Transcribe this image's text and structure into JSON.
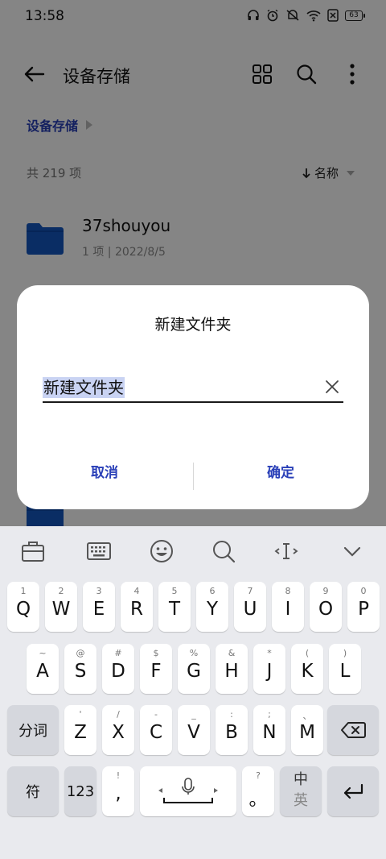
{
  "status": {
    "time": "13:58",
    "battery": "63"
  },
  "toolbar": {
    "title": "设备存储"
  },
  "breadcrumb": {
    "label": "设备存储"
  },
  "list": {
    "count": "共 219 项",
    "sort_label": "名称",
    "items": [
      {
        "name": "37shouyou",
        "meta": "1 项 | 2022/8/5"
      }
    ]
  },
  "dialog": {
    "title": "新建文件夹",
    "input_value": "新建文件夹",
    "cancel_label": "取消",
    "confirm_label": "确定"
  },
  "keyboard": {
    "row1": [
      {
        "hint": "1",
        "key": "Q"
      },
      {
        "hint": "2",
        "key": "W"
      },
      {
        "hint": "3",
        "key": "E"
      },
      {
        "hint": "4",
        "key": "R"
      },
      {
        "hint": "5",
        "key": "T"
      },
      {
        "hint": "6",
        "key": "Y"
      },
      {
        "hint": "7",
        "key": "U"
      },
      {
        "hint": "8",
        "key": "I"
      },
      {
        "hint": "9",
        "key": "O"
      },
      {
        "hint": "0",
        "key": "P"
      }
    ],
    "row2": [
      {
        "hint": "~",
        "key": "A"
      },
      {
        "hint": "@",
        "key": "S"
      },
      {
        "hint": "#",
        "key": "D"
      },
      {
        "hint": "$",
        "key": "F"
      },
      {
        "hint": "%",
        "key": "G"
      },
      {
        "hint": "&",
        "key": "H"
      },
      {
        "hint": "*",
        "key": "J"
      },
      {
        "hint": "(",
        "key": "K"
      },
      {
        "hint": ")",
        "key": "L"
      }
    ],
    "row3": [
      {
        "hint": "'",
        "key": "Z"
      },
      {
        "hint": "/",
        "key": "X"
      },
      {
        "hint": "-",
        "key": "C"
      },
      {
        "hint": "_",
        "key": "V"
      },
      {
        "hint": ":",
        "key": "B"
      },
      {
        "hint": ";",
        "key": "N"
      },
      {
        "hint": "、",
        "key": "M"
      }
    ],
    "fenci": "分词",
    "fu": "符",
    "num": "123",
    "comma_hint": "!",
    "comma": ",",
    "period_hint": "?",
    "period": "。",
    "lang_top": "中",
    "lang_bottom": "英"
  }
}
